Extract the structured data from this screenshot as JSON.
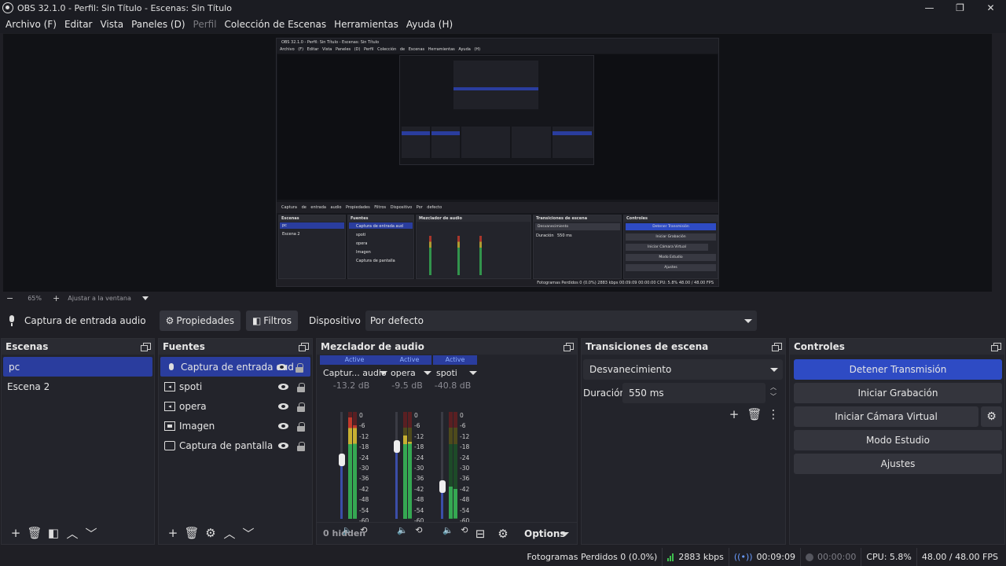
{
  "window": {
    "title": "OBS 32.1.0 - Perfil: Sin Título - Escenas: Sin Título",
    "minimize": "—",
    "maximize": "❐",
    "close": "✕"
  },
  "menu": [
    "Archivo (F)",
    "Editar",
    "Vista",
    "Paneles (D)",
    "Perfil",
    "Colección de Escenas",
    "Herramientas",
    "Ayuda (H)"
  ],
  "preview_frame": {
    "title": "OBS 32.1.0 - Perfil: Sin Título - Escenas: Sin Título",
    "menu": "Archivo (F)  Editar  Vista  Paneles (D)  Perfil  Colección de Escenas  Herramientas  Ayuda (H)",
    "toolbar": "Captura de entrada audio  Propiedades  Filtros  Dispositivo  Por defecto",
    "status": "Fotogramas Perdidos 0 (0.0%)   2883 kbps   00:09:09   00:00:00   CPU: 5.8%   48.00 / 48.00 FPS",
    "scenes_title": "Escenas",
    "scenes": [
      "pc",
      "Escena 2"
    ],
    "sources_title": "Fuentes",
    "sources": [
      "Captura de entrada aud",
      "spoti",
      "opera",
      "Imagen",
      "Captura de pantalla"
    ],
    "mixer_title": "Mezclador de audio",
    "transitions_title": "Transiciones de escena",
    "transition": "Desvanecimiento",
    "duration": "Duración",
    "duration_val": "550 ms",
    "controls_title": "Controles",
    "controls": [
      "Detener Transmisión",
      "Iniciar Grabación",
      "Iniciar Cámara Virtual",
      "Modo Estudio",
      "Ajustes"
    ]
  },
  "preview_toolbar": {
    "minus": "−",
    "zoom": "65%",
    "plus": "+",
    "fit": "Ajustar a la ventana"
  },
  "source_toolbar": {
    "source_name": "Captura de entrada audio",
    "properties": "Propiedades",
    "filters": "Filtros",
    "device_label": "Dispositivo",
    "device_value": "Por defecto"
  },
  "scenes": {
    "title": "Escenas",
    "items": [
      "pc",
      "Escena 2"
    ],
    "selected": 0
  },
  "sources": {
    "title": "Fuentes",
    "items": [
      {
        "label": "Captura de entrada aud",
        "icon": "microphone-icon"
      },
      {
        "label": "spoti",
        "icon": "media-icon"
      },
      {
        "label": "opera",
        "icon": "media-icon"
      },
      {
        "label": "Imagen",
        "icon": "image-icon"
      },
      {
        "label": "Captura de pantalla",
        "icon": "monitor-icon"
      }
    ],
    "selected": 0
  },
  "mixer": {
    "title": "Mezclador de audio",
    "hidden": "0 hidden",
    "options": "Options",
    "scale": [
      "0",
      "-6",
      "-12",
      "-18",
      "-24",
      "-30",
      "-36",
      "-42",
      "-48",
      "-54",
      "-60"
    ],
    "channels": [
      {
        "status": "Active",
        "name": "Captur... audio",
        "db": "-13.2 dB",
        "volume": 0.55,
        "level": 0.95
      },
      {
        "status": "Active",
        "name": "opera",
        "db": "-9.5 dB",
        "volume": 0.68,
        "level": 0.78
      },
      {
        "status": "Active",
        "name": "spoti",
        "db": "-40.8 dB",
        "volume": 0.3,
        "level": 0.3
      }
    ]
  },
  "transitions": {
    "title": "Transiciones de escena",
    "selected": "Desvanecimiento",
    "duration_label": "Duración",
    "duration_value": "550 ms"
  },
  "controls": {
    "title": "Controles",
    "stop_stream": "Detener Transmisión",
    "start_recording": "Iniciar Grabación",
    "start_virtualcam": "Iniciar Cámara Virtual",
    "studio_mode": "Modo Estudio",
    "settings": "Ajustes"
  },
  "status": {
    "dropped_frames": "Fotogramas Perdidos 0 (0.0%)",
    "bitrate": "2883 kbps",
    "stream_time": "00:09:09",
    "record_time": "00:00:00",
    "cpu": "CPU: 5.8%",
    "fps": "48.00 / 48.00 FPS"
  },
  "colors": {
    "accent": "#2a3d9e",
    "primary_button": "#2e4bc4",
    "meter_green": "#35a852",
    "meter_yellow": "#c7b032",
    "meter_red": "#c0392b"
  }
}
